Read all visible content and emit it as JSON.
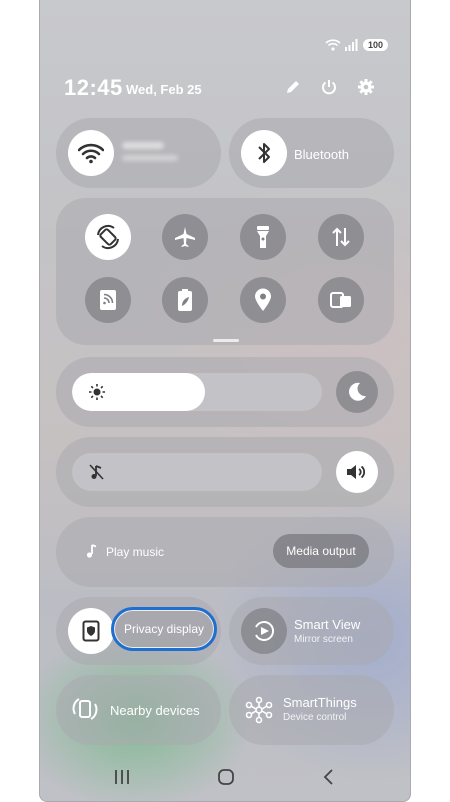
{
  "status": {
    "battery": "100"
  },
  "header": {
    "time": "12:45",
    "date": "Wed, Feb 25"
  },
  "tiles": {
    "bluetooth_label": "Bluetooth"
  },
  "media": {
    "play_music": "Play music",
    "media_output": "Media output"
  },
  "brightness": {
    "level": 0.53
  },
  "privacy": {
    "label": "Privacy display"
  },
  "smart_view": {
    "title": "Smart View",
    "subtitle": "Mirror screen"
  },
  "nearby": {
    "label": "Nearby devices"
  },
  "smartthings": {
    "title": "SmartThings",
    "subtitle": "Device control"
  },
  "colors": {
    "highlight": "#1f6fd0",
    "tile": "#a9a9ae",
    "icon_grey": "#7f7f84"
  }
}
